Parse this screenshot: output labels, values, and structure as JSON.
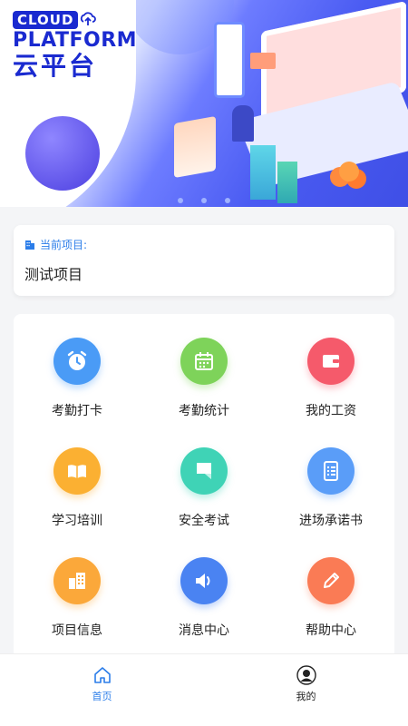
{
  "banner": {
    "logo_cloud": "CLOUD",
    "logo_platform": "PLATFORM",
    "logo_cn": "云平台"
  },
  "project": {
    "label": "当前项目:",
    "value": "测试项目",
    "label_icon": "building-icon"
  },
  "menu": {
    "items": [
      {
        "label": "考勤打卡",
        "icon": "alarm-clock-icon",
        "color": "#4a9bf6"
      },
      {
        "label": "考勤统计",
        "icon": "calendar-icon",
        "color": "#7ed35a"
      },
      {
        "label": "我的工资",
        "icon": "wallet-icon",
        "color": "#f55a6b"
      },
      {
        "label": "学习培训",
        "icon": "book-icon",
        "color": "#fbb032"
      },
      {
        "label": "安全考试",
        "icon": "exam-paper-icon",
        "color": "#3fd3b6"
      },
      {
        "label": "进场承诺书",
        "icon": "document-list-icon",
        "color": "#5a9df8"
      },
      {
        "label": "项目信息",
        "icon": "buildings-icon",
        "color": "#fba83a"
      },
      {
        "label": "消息中心",
        "icon": "speaker-icon",
        "color": "#4a83f2"
      },
      {
        "label": "帮助中心",
        "icon": "pencil-icon",
        "color": "#fa7b55"
      }
    ]
  },
  "tabbar": {
    "home_label": "首页",
    "mine_label": "我的",
    "active_color": "#2b7de9",
    "inactive_color": "#222222"
  }
}
